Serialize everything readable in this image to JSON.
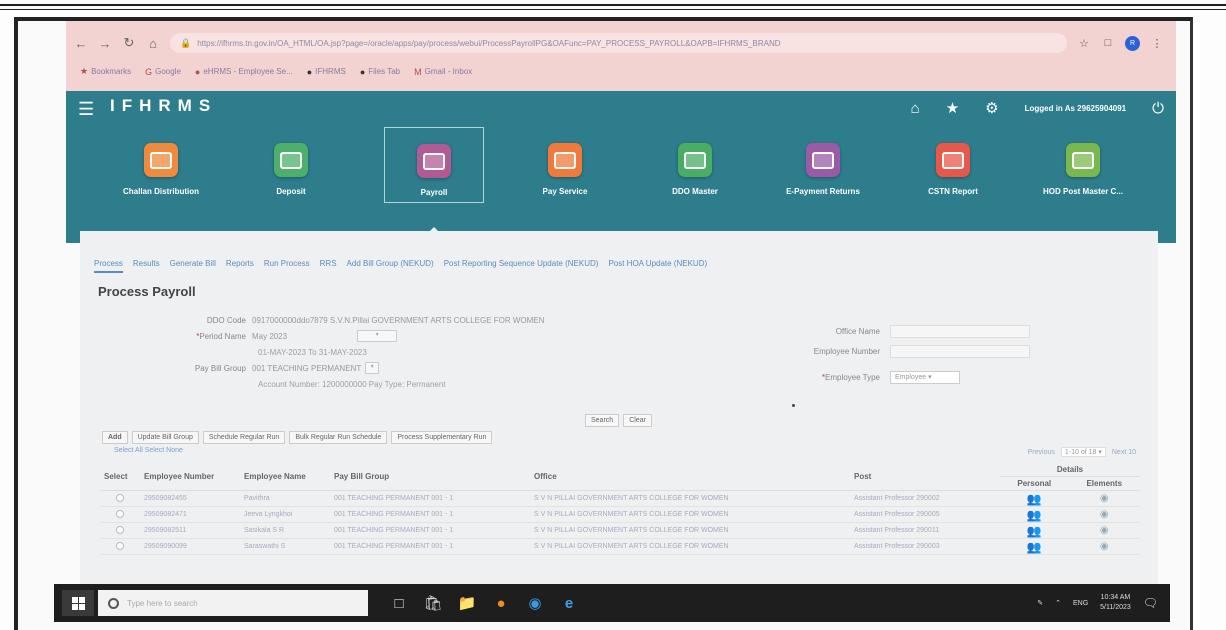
{
  "browser": {
    "url": "https://ifhrms.tn.gov.in/OA_HTML/OA.jsp?page=/oracle/apps/pay/process/webui/ProcessPayrollPG&OAFunc=PAY_PROCESS_PAYROLL&OAPB=IFHRMS_BRAND",
    "bookmarks": [
      "Bookmarks",
      "Google",
      "eHRMS - Employee Se...",
      "IFHRMS",
      "Files Tab",
      "Gmail - Inbox"
    ],
    "profile_initial": "R"
  },
  "header": {
    "brand": "IFHRMS",
    "logged_in": "Logged in As 29625904091"
  },
  "modules": [
    {
      "label": "Challan Distribution",
      "color": "#f08a3c"
    },
    {
      "label": "Deposit",
      "color": "#4caf6a"
    },
    {
      "label": "Payroll",
      "color": "#b05a96"
    },
    {
      "label": "Pay Service",
      "color": "#f07a3c"
    },
    {
      "label": "DDO Master",
      "color": "#49ad64"
    },
    {
      "label": "E-Payment Returns",
      "color": "#9a5aa8"
    },
    {
      "label": "CSTN Report",
      "color": "#e8584a"
    },
    {
      "label": "HOD Post Master C...",
      "color": "#78b84e"
    }
  ],
  "subtabs": [
    "Process",
    "Results",
    "Generate Bill",
    "Reports",
    "Run Process",
    "RRS",
    "Add Bill Group (NEKUD)",
    "Post Reporting Sequence Update (NEKUD)",
    "Post HOA Update (NEKUD)"
  ],
  "page_title": "Process Payroll",
  "form": {
    "ddo_code_label": "DDO Code",
    "ddo_code_value": "0917000000ddo7879 S.V.N.Pillai GOVERNMENT ARTS COLLEGE FOR WOMEN",
    "period_label": "Period Name",
    "period_value": "May 2023",
    "period_range": "01-MAY-2023 To 31-MAY-2023",
    "paybill_label": "Pay Bill Group",
    "paybill_value": "001 TEACHING PERMANENT",
    "paybill_detail": "Account Number: 1200000000 Pay Type: Permanent",
    "office_label": "Office Name",
    "empno_label": "Employee Number",
    "emptype_label": "Employee Type",
    "emptype_value": "Employee"
  },
  "search_buttons": [
    "Search",
    "Clear"
  ],
  "actions": [
    "Add",
    "Update Bill Group",
    "Schedule Regular Run",
    "Bulk Regular Run Schedule",
    "Process Supplementary Run"
  ],
  "table": {
    "view_selector": "Select All  Select None",
    "pager_prev": "Previous",
    "pager_range": "1-10 of 18",
    "pager_next": "Next 10",
    "headers": [
      "Select",
      "Employee Number",
      "Employee Name",
      "Pay Bill Group",
      "Office",
      "Post",
      "Personal",
      "Elements"
    ],
    "details_label": "Details",
    "rows": [
      {
        "num": "29509082455",
        "name": "Pavithra",
        "group": "001 TEACHING PERMANENT 001 - 1",
        "office": "S V N PILLAI GOVERNMENT ARTS COLLEGE FOR WOMEN",
        "post": "Assistant Professor 290002"
      },
      {
        "num": "29509082471",
        "name": "Jeeva Lyngkhoi",
        "group": "001 TEACHING PERMANENT 001 - 1",
        "office": "S V N PILLAI GOVERNMENT ARTS COLLEGE FOR WOMEN",
        "post": "Assistant Professor 290005"
      },
      {
        "num": "29509082511",
        "name": "Sasikala S R",
        "group": "001 TEACHING PERMANENT 001 - 1",
        "office": "S V N PILLAI GOVERNMENT ARTS COLLEGE FOR WOMEN",
        "post": "Assistant Professor 290011"
      },
      {
        "num": "29509090099",
        "name": "Saraswathi S",
        "group": "001 TEACHING PERMANENT 001 - 1",
        "office": "S V N PILLAI GOVERNMENT ARTS COLLEGE FOR WOMEN",
        "post": "Assistant Professor 290003"
      }
    ]
  },
  "taskbar": {
    "search_placeholder": "Type here to search",
    "lang": "ENG",
    "time": "10:34 AM",
    "date": "5/11/2023"
  }
}
